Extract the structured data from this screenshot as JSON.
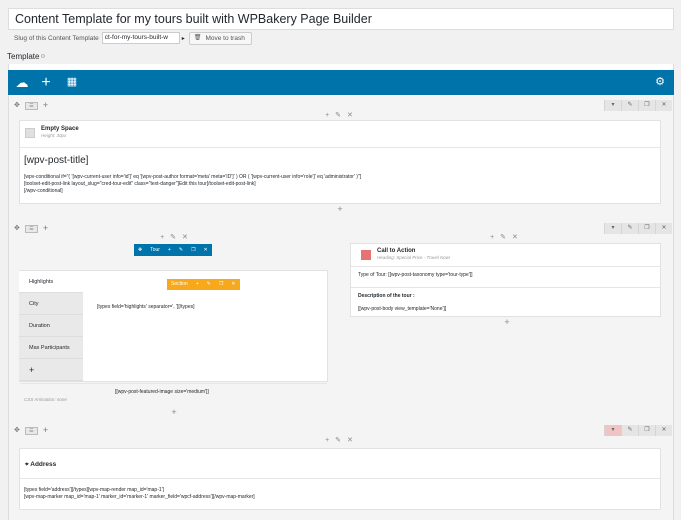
{
  "post": {
    "title": "Content Template for my tours built with WPBakery Page Builder",
    "slug_label": "Slug of this Content Template",
    "slug_value": "ct-for-my-tours-built-w",
    "trash_label": "Move to trash",
    "section_label": "Template"
  },
  "rows": {
    "row1": {
      "empty_space_title": "Empty Space",
      "empty_space_sub": "Height: 30px",
      "post_title": "[wpv-post-title]",
      "code": "[wpv-conditional if=\"( '[wpv-current-user info='id']' eq '[wpv-post-author format='meta' meta='ID']' ) OR ( '[wpv-current-user info='role']' eq 'administrator' )\"]\n[toolset-edit-post-link layout_slug=\"cred-tour-edit\" class=\"text-danger\"]Edit this tour[/toolset-edit-post-link]\n[/wpv-conditional]"
    },
    "row2": {
      "tour_label": "Tour",
      "section_label": "Section",
      "tabs": [
        "Highlights",
        "City",
        "Duration",
        "Max Participants",
        "+"
      ],
      "tab_content": "[types field='highlights' separator=', '][/types]",
      "featured_image": "[[wpv-post-featured-image size='medium']]",
      "css_animation": "CSS Animation: none",
      "cta_title": "Call to Action",
      "cta_sub": "Heading: Special Price - Travel Now!",
      "cta_type": "Type of Tour: [[wpv-post-taxonomy type='tour-type']]",
      "cta_desc_label": "Description of the tour :",
      "cta_body": "[[wpv-post-body view_template='None']]"
    },
    "row3": {
      "address_title": "Address",
      "code": "[types field='address'][/types][wpv-map-render map_id='map-1']\n[wpv-map-marker map_id='map-1' marker_id='marker-1' marker_field='wpcf-address'][/wpv-map-marker]"
    }
  },
  "colors": {
    "accent": "#0073aa",
    "section": "#f7a81b",
    "cta": "#e57373"
  }
}
